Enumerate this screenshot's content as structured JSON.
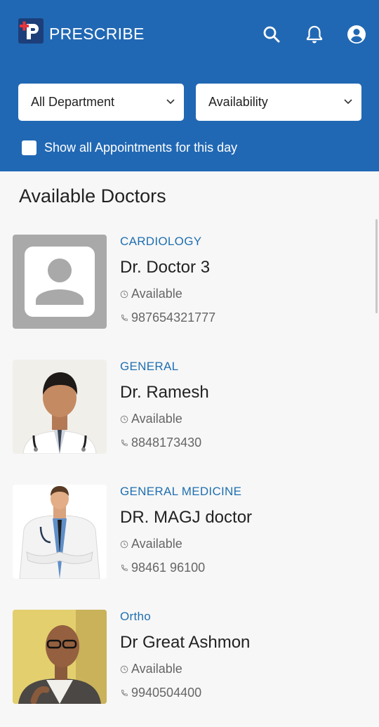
{
  "app": {
    "brand": "PRESCRIBE"
  },
  "colors": {
    "header": "#2168b4",
    "accent": "#1f6fb0",
    "background": "#f7f7f7"
  },
  "header_icons": [
    "search-icon",
    "bell-icon",
    "account-icon"
  ],
  "filters": {
    "department": "All Department",
    "availability": "Availability",
    "show_all_label": "Show all Appointments for this day"
  },
  "section_title": "Available Doctors",
  "doctors": [
    {
      "department": "CARDIOLOGY",
      "name": "Dr. Doctor 3",
      "status": "Available",
      "phone": "987654321777"
    },
    {
      "department": "GENERAL",
      "name": "Dr. Ramesh",
      "status": "Available",
      "phone": "8848173430"
    },
    {
      "department": "GENERAL MEDICINE",
      "name": "DR. MAGJ doctor",
      "status": "Available",
      "phone": "98461 96100"
    },
    {
      "department": "Ortho",
      "name": "Dr Great Ashmon",
      "status": "Available",
      "phone": "9940504400"
    }
  ]
}
